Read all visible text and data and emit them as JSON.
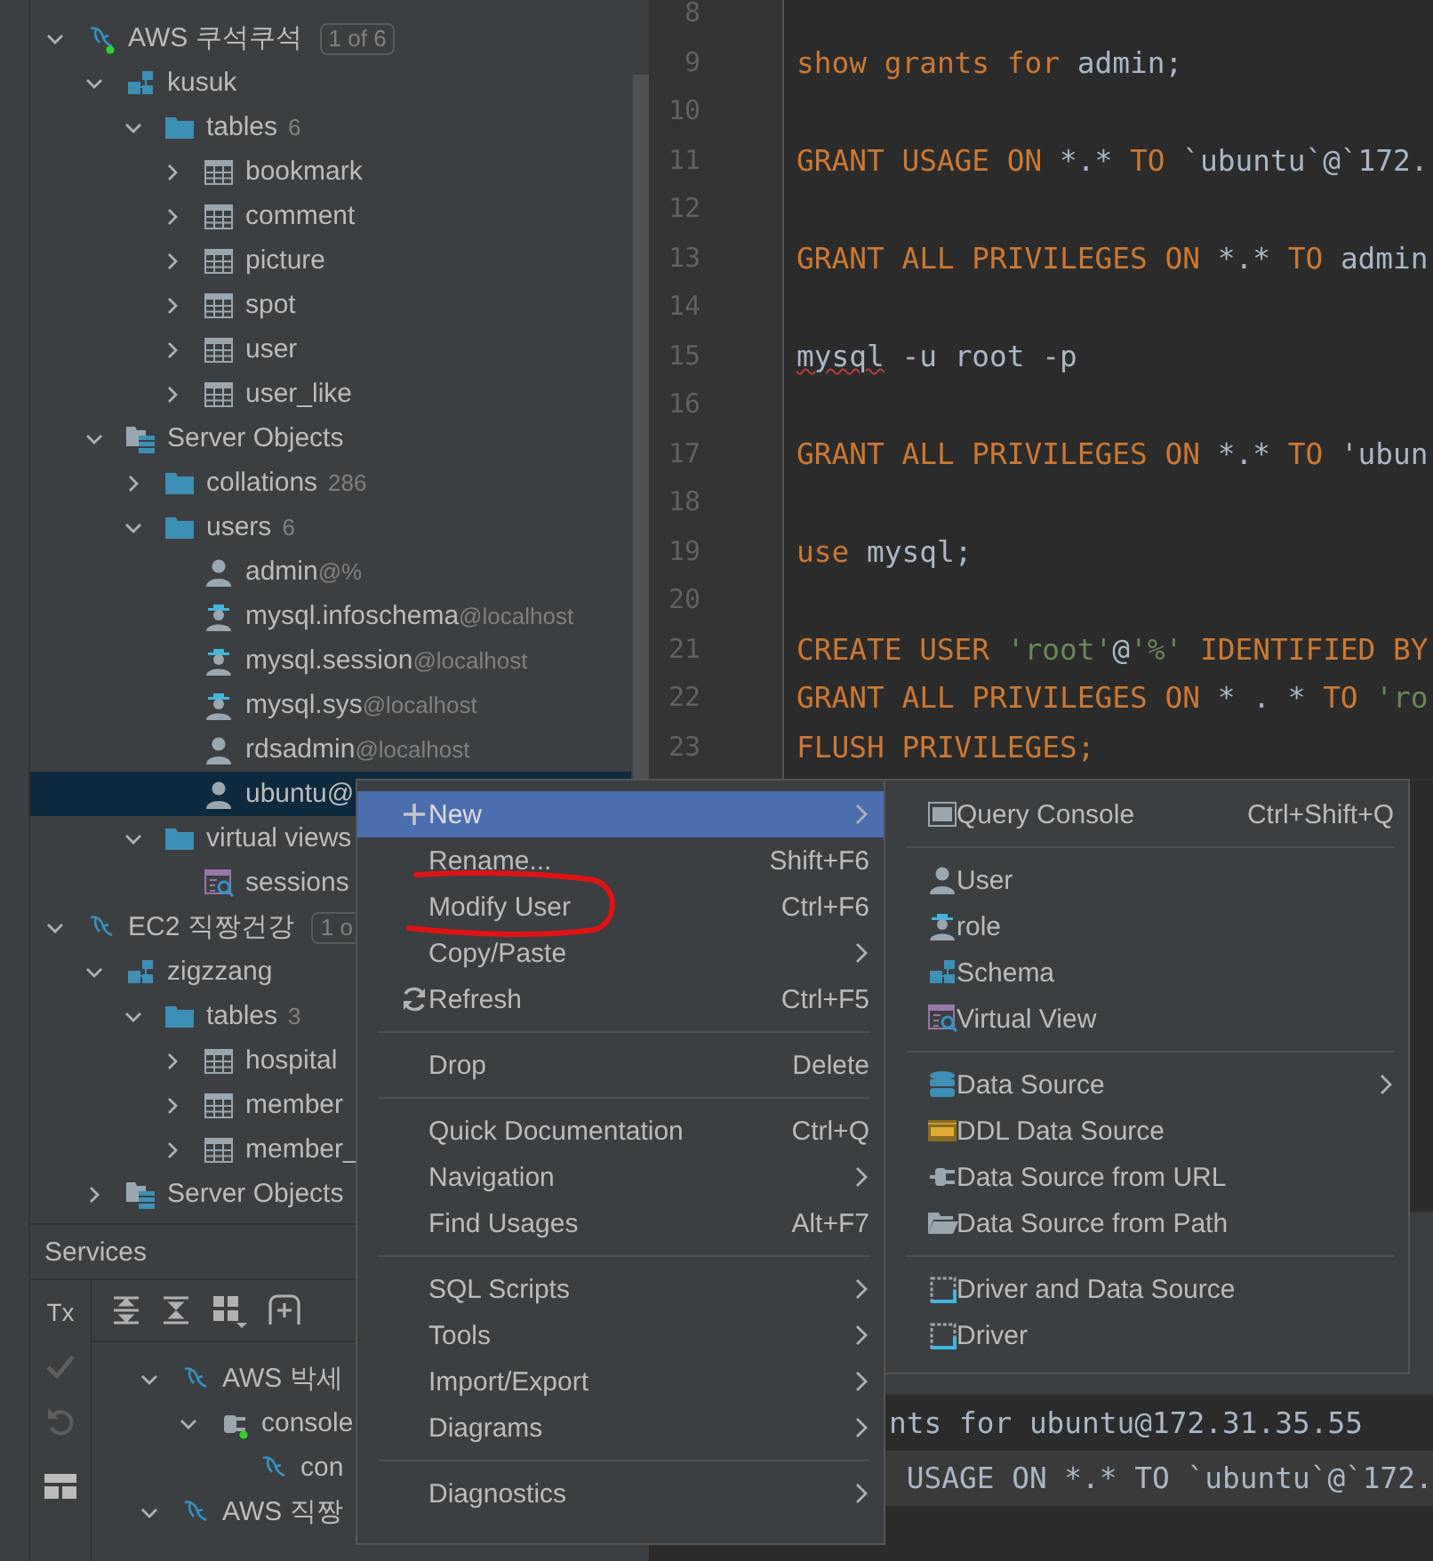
{
  "tree": [
    {
      "name": "AWS 쿠석쿠석",
      "kind": "datasource",
      "connected": true,
      "badge": "1 of 6",
      "expanded": true,
      "selected": false,
      "children": [
        {
          "name": "kusuk",
          "kind": "schema",
          "expanded": true,
          "selected": false,
          "children": [
            {
              "name": "tables",
              "kind": "folder",
              "count": "6",
              "expanded": true,
              "selected": false,
              "children": [
                {
                  "name": "bookmark",
                  "kind": "table",
                  "expanded": false,
                  "selected": false
                },
                {
                  "name": "comment",
                  "kind": "table",
                  "expanded": false,
                  "selected": false
                },
                {
                  "name": "picture",
                  "kind": "table",
                  "expanded": false,
                  "selected": false
                },
                {
                  "name": "spot",
                  "kind": "table",
                  "expanded": false,
                  "selected": false
                },
                {
                  "name": "user",
                  "kind": "table",
                  "expanded": false,
                  "selected": false
                },
                {
                  "name": "user_like",
                  "kind": "table",
                  "expanded": false,
                  "selected": false
                }
              ]
            }
          ]
        },
        {
          "name": "Server Objects",
          "kind": "server-objects",
          "expanded": true,
          "selected": false,
          "children": [
            {
              "name": "collations",
              "kind": "folder",
              "count": "286",
              "expanded": false,
              "selected": false
            },
            {
              "name": "users",
              "kind": "folder",
              "count": "6",
              "expanded": true,
              "selected": false,
              "children": [
                {
                  "name": "admin",
                  "host": "@%",
                  "kind": "user",
                  "selected": false
                },
                {
                  "name": "mysql.infoschema",
                  "host": "@localhost",
                  "kind": "role",
                  "selected": false
                },
                {
                  "name": "mysql.session",
                  "host": "@localhost",
                  "kind": "role",
                  "selected": false
                },
                {
                  "name": "mysql.sys",
                  "host": "@localhost",
                  "kind": "role",
                  "selected": false
                },
                {
                  "name": "rdsadmin",
                  "host": "@localhost",
                  "kind": "user",
                  "selected": false
                },
                {
                  "name": "ubuntu@",
                  "kind": "user",
                  "selected": true
                }
              ]
            },
            {
              "name": "virtual views",
              "kind": "folder",
              "expanded": true,
              "selected": false,
              "children": [
                {
                  "name": "sessions",
                  "kind": "virtual-view",
                  "selected": false
                }
              ]
            }
          ]
        }
      ]
    },
    {
      "name": "EC2 직짱건강",
      "kind": "datasource",
      "connected": false,
      "badge": "1 o",
      "expanded": true,
      "selected": false,
      "children": [
        {
          "name": "zigzzang",
          "kind": "schema",
          "expanded": true,
          "selected": false,
          "children": [
            {
              "name": "tables",
              "kind": "folder",
              "count": "3",
              "expanded": true,
              "selected": false,
              "children": [
                {
                  "name": "hospital",
                  "kind": "table",
                  "expanded": false,
                  "selected": false
                },
                {
                  "name": "member",
                  "kind": "table",
                  "expanded": false,
                  "selected": false
                },
                {
                  "name": "member_",
                  "kind": "table",
                  "expanded": false,
                  "selected": false
                }
              ]
            }
          ]
        },
        {
          "name": "Server Objects",
          "kind": "server-objects",
          "expanded": false,
          "selected": false
        }
      ]
    }
  ],
  "services": {
    "title": "Services",
    "tx_label": "Tx",
    "tree": [
      {
        "name": "AWS 박세",
        "kind": "datasource",
        "connected": false,
        "expanded": true,
        "selected": false,
        "children": [
          {
            "name": "console",
            "kind": "console",
            "connected": true,
            "expanded": true,
            "selected": false,
            "children": [
              {
                "name": "con",
                "kind": "datasource",
                "connected": false,
                "selected": false
              }
            ]
          }
        ]
      },
      {
        "name": "AWS 직짱",
        "kind": "datasource",
        "connected": false,
        "expanded": true,
        "selected": false
      }
    ]
  },
  "editor": {
    "lines": [
      {
        "number": "8"
      },
      {
        "number": "9",
        "tokens": [
          {
            "text": "show grants for ",
            "kind": "keyword"
          },
          {
            "text": "admin;",
            "kind": "plain"
          }
        ]
      },
      {
        "number": "10"
      },
      {
        "number": "11",
        "tokens": [
          {
            "text": "GRANT USAGE ON ",
            "kind": "keyword"
          },
          {
            "text": "*.* ",
            "kind": "plain"
          },
          {
            "text": "TO ",
            "kind": "keyword"
          },
          {
            "text": "`ubuntu`@`172.",
            "kind": "plain"
          }
        ]
      },
      {
        "number": "12"
      },
      {
        "number": "13",
        "tokens": [
          {
            "text": "GRANT ALL PRIVILEGES ON ",
            "kind": "keyword"
          },
          {
            "text": "*.* ",
            "kind": "plain"
          },
          {
            "text": "TO ",
            "kind": "keyword"
          },
          {
            "text": "admin",
            "kind": "plain"
          }
        ]
      },
      {
        "number": "14"
      },
      {
        "number": "15",
        "tokens": [
          {
            "text": "mysql",
            "kind": "error"
          },
          {
            "text": " -u root -p",
            "kind": "plain"
          }
        ]
      },
      {
        "number": "16"
      },
      {
        "number": "17",
        "tokens": [
          {
            "text": "GRANT ALL PRIVILEGES ON ",
            "kind": "keyword"
          },
          {
            "text": "*.* ",
            "kind": "plain"
          },
          {
            "text": "TO ",
            "kind": "keyword"
          },
          {
            "text": "'ubun",
            "kind": "plain"
          }
        ]
      },
      {
        "number": "18"
      },
      {
        "number": "19",
        "tokens": [
          {
            "text": "use ",
            "kind": "keyword"
          },
          {
            "text": "mysql;",
            "kind": "plain"
          }
        ]
      },
      {
        "number": "20"
      },
      {
        "number": "21",
        "tokens": [
          {
            "text": "CREATE USER ",
            "kind": "keyword"
          },
          {
            "text": "'root'",
            "kind": "string"
          },
          {
            "text": "@",
            "kind": "plain"
          },
          {
            "text": "'%'",
            "kind": "string"
          },
          {
            "text": " IDENTIFIED BY",
            "kind": "keyword"
          }
        ]
      },
      {
        "number": "22",
        "tokens": [
          {
            "text": "GRANT ALL PRIVILEGES ON ",
            "kind": "keyword"
          },
          {
            "text": "* . * ",
            "kind": "plain"
          },
          {
            "text": "TO ",
            "kind": "keyword"
          },
          {
            "text": "'ro",
            "kind": "string"
          }
        ]
      },
      {
        "number": "23",
        "tokens": [
          {
            "text": "FLUSH PRIVILEGES;",
            "kind": "keyword"
          }
        ]
      }
    ]
  },
  "output": {
    "lines": [
      {
        "text": "nts for ubuntu@172.31.35.55",
        "selected": false
      },
      {
        "text": " USAGE ON *.* TO `ubuntu`@`172.",
        "selected": true
      }
    ]
  },
  "context_menu": {
    "items": [
      {
        "kind": "item",
        "label": "New",
        "submenu": true,
        "selected": true
      },
      {
        "kind": "item",
        "label": "Rename...",
        "shortcut": "Shift+F6",
        "selected": false
      },
      {
        "kind": "item",
        "label": "Modify User",
        "shortcut": "Ctrl+F6",
        "selected": false,
        "annotated": true
      },
      {
        "kind": "item",
        "label": "Copy/Paste",
        "submenu": true,
        "selected": false
      },
      {
        "kind": "item",
        "label": "Refresh",
        "shortcut": "Ctrl+F5",
        "selected": false
      },
      {
        "kind": "separator"
      },
      {
        "kind": "item",
        "label": "Drop",
        "shortcut": "Delete",
        "selected": false
      },
      {
        "kind": "separator"
      },
      {
        "kind": "item",
        "label": "Quick Documentation",
        "shortcut": "Ctrl+Q",
        "selected": false
      },
      {
        "kind": "item",
        "label": "Navigation",
        "submenu": true,
        "selected": false
      },
      {
        "kind": "item",
        "label": "Find Usages",
        "shortcut": "Alt+F7",
        "selected": false
      },
      {
        "kind": "separator"
      },
      {
        "kind": "item",
        "label": "SQL Scripts",
        "submenu": true,
        "selected": false
      },
      {
        "kind": "item",
        "label": "Tools",
        "submenu": true,
        "selected": false
      },
      {
        "kind": "item",
        "label": "Import/Export",
        "submenu": true,
        "selected": false
      },
      {
        "kind": "item",
        "label": "Diagrams",
        "submenu": true,
        "selected": false
      },
      {
        "kind": "separator"
      },
      {
        "kind": "item",
        "label": "Diagnostics",
        "submenu": true,
        "selected": false
      }
    ]
  },
  "submenu": {
    "items": [
      {
        "kind": "item",
        "label": "Query Console",
        "shortcut": "Ctrl+Shift+Q",
        "selected": false
      },
      {
        "kind": "separator"
      },
      {
        "kind": "item",
        "label": "User",
        "selected": false
      },
      {
        "kind": "item",
        "label": "role",
        "selected": false
      },
      {
        "kind": "item",
        "label": "Schema",
        "selected": false
      },
      {
        "kind": "item",
        "label": "Virtual View",
        "selected": false
      },
      {
        "kind": "separator"
      },
      {
        "kind": "item",
        "label": "Data Source",
        "submenu": true,
        "selected": false
      },
      {
        "kind": "item",
        "label": "DDL Data Source",
        "selected": false
      },
      {
        "kind": "item",
        "label": "Data Source from URL",
        "selected": false
      },
      {
        "kind": "item",
        "label": "Data Source from Path",
        "selected": false
      },
      {
        "kind": "separator"
      },
      {
        "kind": "item",
        "label": "Driver and Data Source",
        "selected": false
      },
      {
        "kind": "item",
        "label": "Driver",
        "selected": false
      }
    ]
  }
}
